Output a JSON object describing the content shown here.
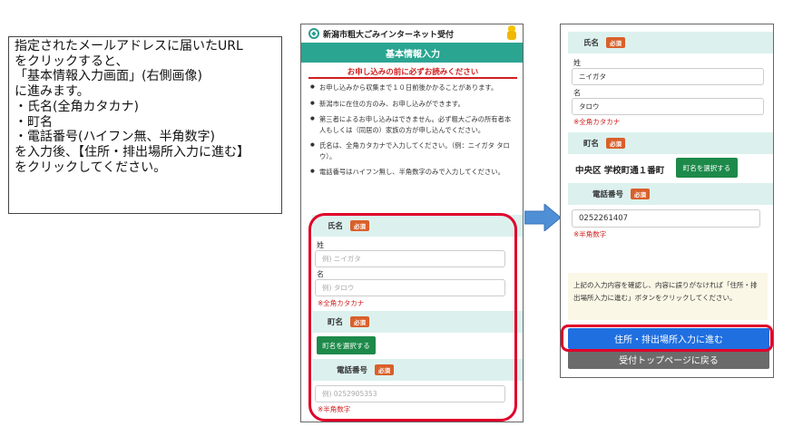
{
  "instruction": {
    "lines": [
      "指定されたメールアドレスに届いたURL",
      "をクリックすると、",
      "「基本情報入力画面」(右側画像)",
      "に進みます。",
      "・氏名(全角カタカナ)",
      "・町名",
      "・電話番号(ハイフン無、半角数字)",
      "を入力後、【住所・排出場所入力に進む】",
      "をクリックしてください。"
    ]
  },
  "left_screen": {
    "header_title": "新潟市粗大ごみインターネット受付",
    "banner": "基本情報入力",
    "notice_title": "お申し込みの前に必ずお読みください",
    "bullets": [
      "お申し込みから収集まで１０日前後かかることがあります。",
      "新潟市に在住の方のみ、お申し込みができます。",
      "第三者によるお申し込みはできません。必ず粗大ごみの所有者本人もしくは（同居の）家族の方が申し込んでください。",
      "氏名は、全角カタカナで入力してください。（例：ニイガタ タロウ）。",
      "電話番号はハイフン無し、半角数字のみで入力してください。"
    ],
    "name_section": "氏名",
    "required": "必須",
    "sei_label": "姓",
    "sei_placeholder": "例) ニイガタ",
    "mei_label": "名",
    "mei_placeholder": "例) タロウ",
    "kana_note": "※全角カタカナ",
    "town_section": "町名",
    "town_button": "町名を選択する",
    "phone_section": "電話番号",
    "phone_placeholder": "例) 0252905353",
    "phone_note": "※半角数字"
  },
  "right_screen": {
    "name_section": "氏名",
    "required": "必須",
    "sei_label": "姓",
    "sei_value": "ニイガタ",
    "mei_label": "名",
    "mei_value": "タロウ",
    "kana_note": "※全角カタカナ",
    "town_section": "町名",
    "town_value": "中央区 学校町通１番町",
    "town_button": "町名を選択する",
    "phone_section": "電話番号",
    "phone_value": "0252261407",
    "phone_note": "※半角数字",
    "info_text": "上記の入力内容を確認し、内容に誤りがなければ「住所・排出場所入力に進む」ボタンをクリックしてください。",
    "next_button": "住所・排出場所入力に進む",
    "back_button": "受付トップページに戻る"
  },
  "colors": {
    "teal": "#2aa592",
    "highlight_red": "#e0002a",
    "arrow_blue": "#4f8fd6",
    "next_blue": "#1f6fe0"
  }
}
